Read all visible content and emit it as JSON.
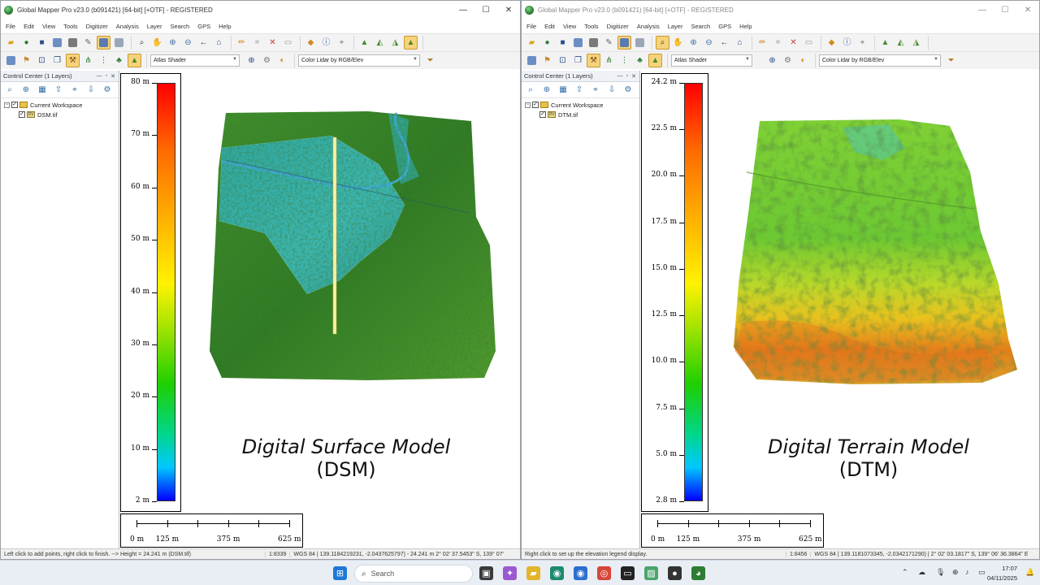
{
  "left": {
    "title": "Global Mapper Pro v23.0 (b091421) [64-bit] [+OTF] - REGISTERED",
    "menu": [
      "File",
      "Edit",
      "View",
      "Tools",
      "Digitizer",
      "Analysis",
      "Layer",
      "Search",
      "GPS",
      "Help"
    ],
    "shader_combo": "Atlas Shader",
    "color_combo": "Color Lidar by RGB/Elev",
    "control_center_title": "Control Center (1 Layers)",
    "workspace_label": "Current Workspace",
    "layer_label": "DSM.tif",
    "legend_labels": [
      "80 m",
      "70 m",
      "60 m",
      "50 m",
      "40 m",
      "30 m",
      "20 m",
      "10 m",
      "2 m"
    ],
    "scale_labels": [
      "0 m",
      "125 m",
      "375 m",
      "625 m"
    ],
    "caption_line1": "Digital Surface Model",
    "caption_line2": "(DSM)",
    "status_message": "Left click to add points, right click to finish. --> Height = 24.241 m (DSM.tif)",
    "status_scale": "1:8339",
    "status_coords": "WGS 84 | 139.1184219231, -2.0437625797) - 24.241 m  2° 02' 37.5453\" S, 139° 07'"
  },
  "right": {
    "title": "Global Mapper Pro v23.0 (b091421) [64-bit] [+OTF] - REGISTERED",
    "menu": [
      "File",
      "Edit",
      "View",
      "Tools",
      "Digitizer",
      "Analysis",
      "Layer",
      "Search",
      "GPS",
      "Help"
    ],
    "shader_combo": "Atlas Shader",
    "color_combo": "Color Lidar by RGB/Elev",
    "control_center_title": "Control Center (1 Layers)",
    "workspace_label": "Current Workspace",
    "layer_label": "DTM.tif",
    "legend_labels": [
      "24.2 m",
      "22.5 m",
      "20.0 m",
      "17.5 m",
      "15.0 m",
      "12.5 m",
      "10.0 m",
      "7.5 m",
      "5.0 m",
      "2.8 m"
    ],
    "scale_labels": [
      "0 m",
      "125 m",
      "375 m",
      "625 m"
    ],
    "caption_line1": "Digital Terrain Model",
    "caption_line2": "(DTM)",
    "status_message": "Right click to set up the elevation legend display.",
    "status_scale": "1:8456",
    "status_coords": "WGS 84 | 139.1181073345, -2.0342171290) | 2° 02' 03.1817\" S, 139° 06' 36.3864\" E"
  },
  "taskbar": {
    "search_placeholder": "Search",
    "time": "17:07",
    "date": "04/11/2025"
  }
}
